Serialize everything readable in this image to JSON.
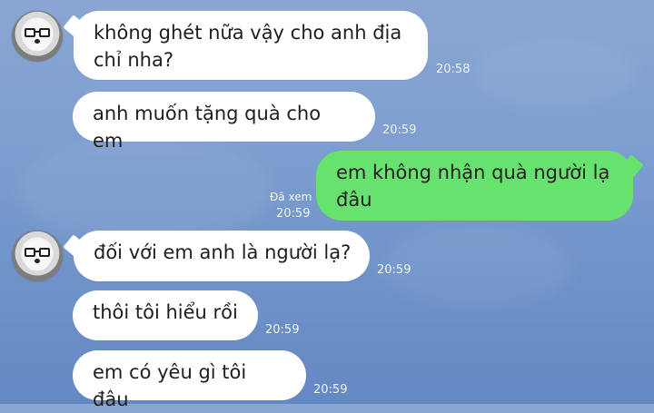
{
  "chat": {
    "background_color": "#7a9bcf",
    "messages": [
      {
        "from": "other",
        "text": "không ghét nữa vậy cho anh địa chỉ nha?",
        "time": "20:58"
      },
      {
        "from": "other",
        "text": "anh muốn tặng quà cho em",
        "time": "20:59"
      },
      {
        "from": "me",
        "text": "em không nhận quà người lạ đâu",
        "seen": "Đã xem",
        "time": "20:59"
      },
      {
        "from": "other",
        "text": "đối với em anh là người lạ?",
        "time": "20:59"
      },
      {
        "from": "other",
        "text": "thôi tôi hiểu rồi",
        "time": "20:59"
      },
      {
        "from": "other",
        "text": "em có yêu gì tôi đâu",
        "time": "20:59"
      }
    ],
    "sent_bubble_color": "#68e26f",
    "received_bubble_color": "#ffffff"
  }
}
